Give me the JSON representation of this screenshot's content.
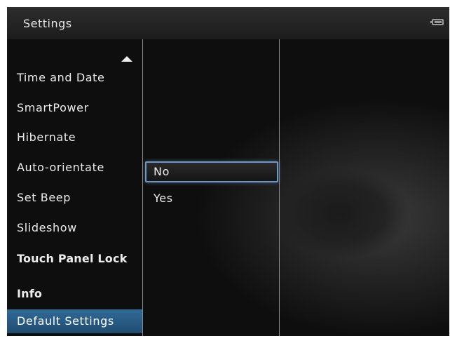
{
  "header": {
    "title": "Settings",
    "battery_icon": "battery-icon"
  },
  "menu": {
    "scroll_icon": "triangle-up-icon",
    "items": [
      {
        "label": "Time and Date"
      },
      {
        "label": "SmartPower"
      },
      {
        "label": "Hibernate"
      },
      {
        "label": "Auto-orientate"
      },
      {
        "label": "Set Beep"
      },
      {
        "label": "Slideshow"
      },
      {
        "label": "Touch Panel Lock"
      },
      {
        "label": "Info"
      },
      {
        "label": "Default Settings"
      }
    ],
    "selected_index": 8
  },
  "options": {
    "items": [
      {
        "label": "No"
      },
      {
        "label": "Yes"
      }
    ],
    "selected_index": 0
  },
  "colors": {
    "selection_blue": "#2a5e8a",
    "focus_border": "#6e98c4",
    "text": "#ececec"
  }
}
